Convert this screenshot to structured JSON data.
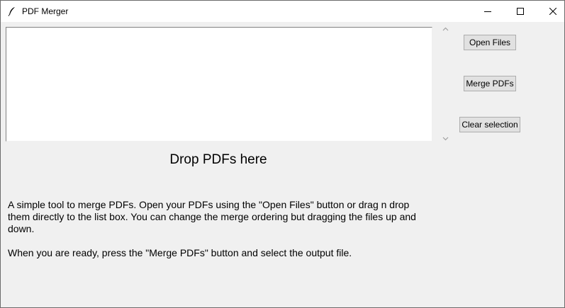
{
  "window": {
    "title": "PDF Merger",
    "app_icon": "feather-icon",
    "controls": {
      "minimize_icon": "minimize-icon",
      "maximize_icon": "maximize-icon",
      "close_icon": "close-icon"
    }
  },
  "listbox": {
    "items": []
  },
  "buttons": {
    "open_files": "Open Files",
    "merge_pdfs": "Merge PDFs",
    "clear_selection": "Clear selection"
  },
  "drop_label": "Drop PDFs here",
  "description": "A simple tool to merge PDFs. Open your PDFs using the \"Open Files\" button or drag n drop them directly to the list box. You can change the merge ordering but dragging the files up and down.",
  "instructions": "When you are ready, press the \"Merge PDFs\" button and select the output file.",
  "colors": {
    "background": "#f0f0f0",
    "titlebar": "#ffffff",
    "button_face": "#e1e1e1",
    "button_border": "#adadad"
  }
}
